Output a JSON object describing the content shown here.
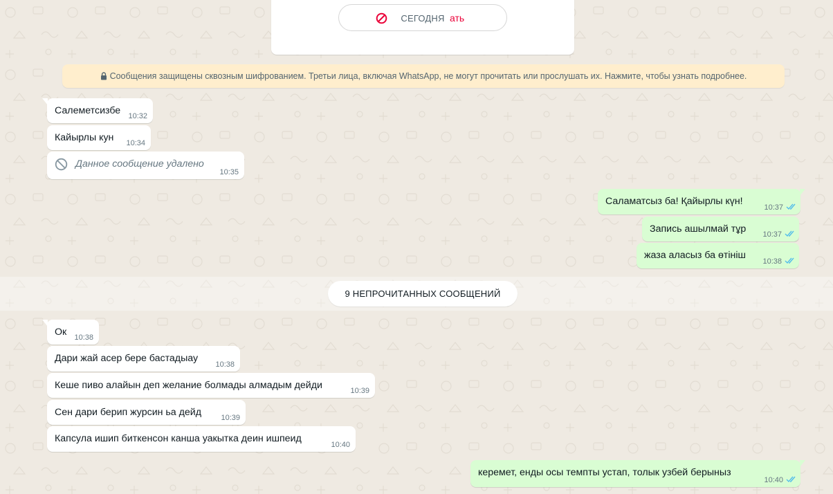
{
  "header": {
    "date_label": "СЕГОДНЯ",
    "block_button_partial": "ать"
  },
  "encryption": {
    "text": "Сообщения защищены сквозным шифрованием. Третьи лица, включая WhatsApp, не могут прочитать или прослушать их. Нажмите, чтобы узнать подробнее."
  },
  "messages_before": [
    {
      "dir": "in",
      "text": "Салеметсизбе",
      "time": "10:32"
    },
    {
      "dir": "in",
      "text": "Кайырлы кун",
      "time": "10:34"
    },
    {
      "dir": "in",
      "text": "Данное сообщение удалено",
      "time": "10:35",
      "deleted": true
    },
    {
      "dir": "out",
      "text": "Саламатсыз ба! Қайырлы күн!",
      "time": "10:37",
      "status": "read"
    },
    {
      "dir": "out",
      "text": "Запись ашылмай тұр",
      "time": "10:37",
      "status": "read"
    },
    {
      "dir": "out",
      "text": "жаза аласыз ба өтініш",
      "time": "10:38",
      "status": "read"
    }
  ],
  "unread_divider": "9 НЕПРОЧИТАННЫХ СООБЩЕНИЙ",
  "messages_after": [
    {
      "dir": "in",
      "text": "Ок",
      "time": "10:38"
    },
    {
      "dir": "in",
      "text": "Дари жай асер бере бастадыау",
      "time": "10:38"
    },
    {
      "dir": "in",
      "text": "Кеше пиво алайын деп желание болмады алмадым дейди",
      "time": "10:39"
    },
    {
      "dir": "in",
      "text": "Сен дари берип журсин ьа дейд",
      "time": "10:39"
    },
    {
      "dir": "in",
      "text": "Капсула ишип биткенсон канша уакытка деин ишпеид",
      "time": "10:40"
    },
    {
      "dir": "out",
      "text": "керемет, енды осы темпты устап, толык узбей берыныз",
      "time": "10:40",
      "status": "read"
    }
  ],
  "colors": {
    "wallpaper": "#efeae2",
    "incoming": "#ffffff",
    "outgoing": "#d9fdd3",
    "read_ticks": "#53bdeb",
    "block_red": "#ea0038",
    "encryption_bg": "#ffeecd"
  },
  "icons": [
    "block-icon",
    "lock-icon",
    "deleted-icon",
    "double-check-icon"
  ]
}
